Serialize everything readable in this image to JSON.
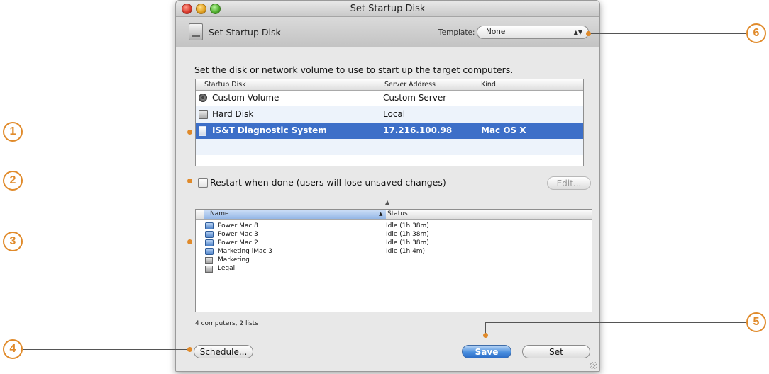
{
  "window": {
    "title": "Set Startup Disk"
  },
  "toolbar": {
    "title": "Set Startup Disk",
    "template_label": "Template:",
    "template_value": "None",
    "template_arrows": "▲▼"
  },
  "instruction": "Set the disk or network volume to use to start up the target computers.",
  "disk_table": {
    "columns": [
      "Startup Disk",
      "Server Address",
      "Kind"
    ],
    "rows": [
      {
        "icon": "gear-icon",
        "disk": "Custom Volume",
        "server": "Custom Server",
        "kind": ""
      },
      {
        "icon": "hard-disk-icon",
        "disk": "Hard Disk",
        "server": "Local",
        "kind": ""
      },
      {
        "icon": "network-disk-icon",
        "disk": "IS&T Diagnostic System",
        "server": "17.216.100.98",
        "kind": "Mac OS X",
        "selected": true
      }
    ]
  },
  "restart": {
    "label": "Restart when done (users will lose unsaved changes)",
    "checked": false
  },
  "edit_button": "Edit...",
  "computer_list": {
    "columns": [
      "Name",
      "Status"
    ],
    "sort_indicator": "▲",
    "rows": [
      {
        "icon": "computer-icon",
        "name": "Power Mac 8",
        "status": "Idle (1h 38m)"
      },
      {
        "icon": "computer-icon",
        "name": "Power Mac 3",
        "status": "Idle (1h 38m)"
      },
      {
        "icon": "computer-icon",
        "name": "Power Mac 2",
        "status": "Idle (1h 38m)"
      },
      {
        "icon": "computer-icon",
        "name": "Marketing iMac 3",
        "status": "Idle (1h 4m)"
      },
      {
        "icon": "computer-list-icon",
        "name": "Marketing",
        "status": ""
      },
      {
        "icon": "computer-list-icon",
        "name": "Legal",
        "status": ""
      }
    ]
  },
  "summary": "4 computers, 2 lists",
  "buttons": {
    "schedule": "Schedule...",
    "save": "Save",
    "set": "Set"
  },
  "callouts": [
    "1",
    "2",
    "3",
    "4",
    "5",
    "6"
  ],
  "colors": {
    "selection": "#3d6fc8",
    "callout": "#e08a2a",
    "default_button": "#2c6dc6"
  }
}
